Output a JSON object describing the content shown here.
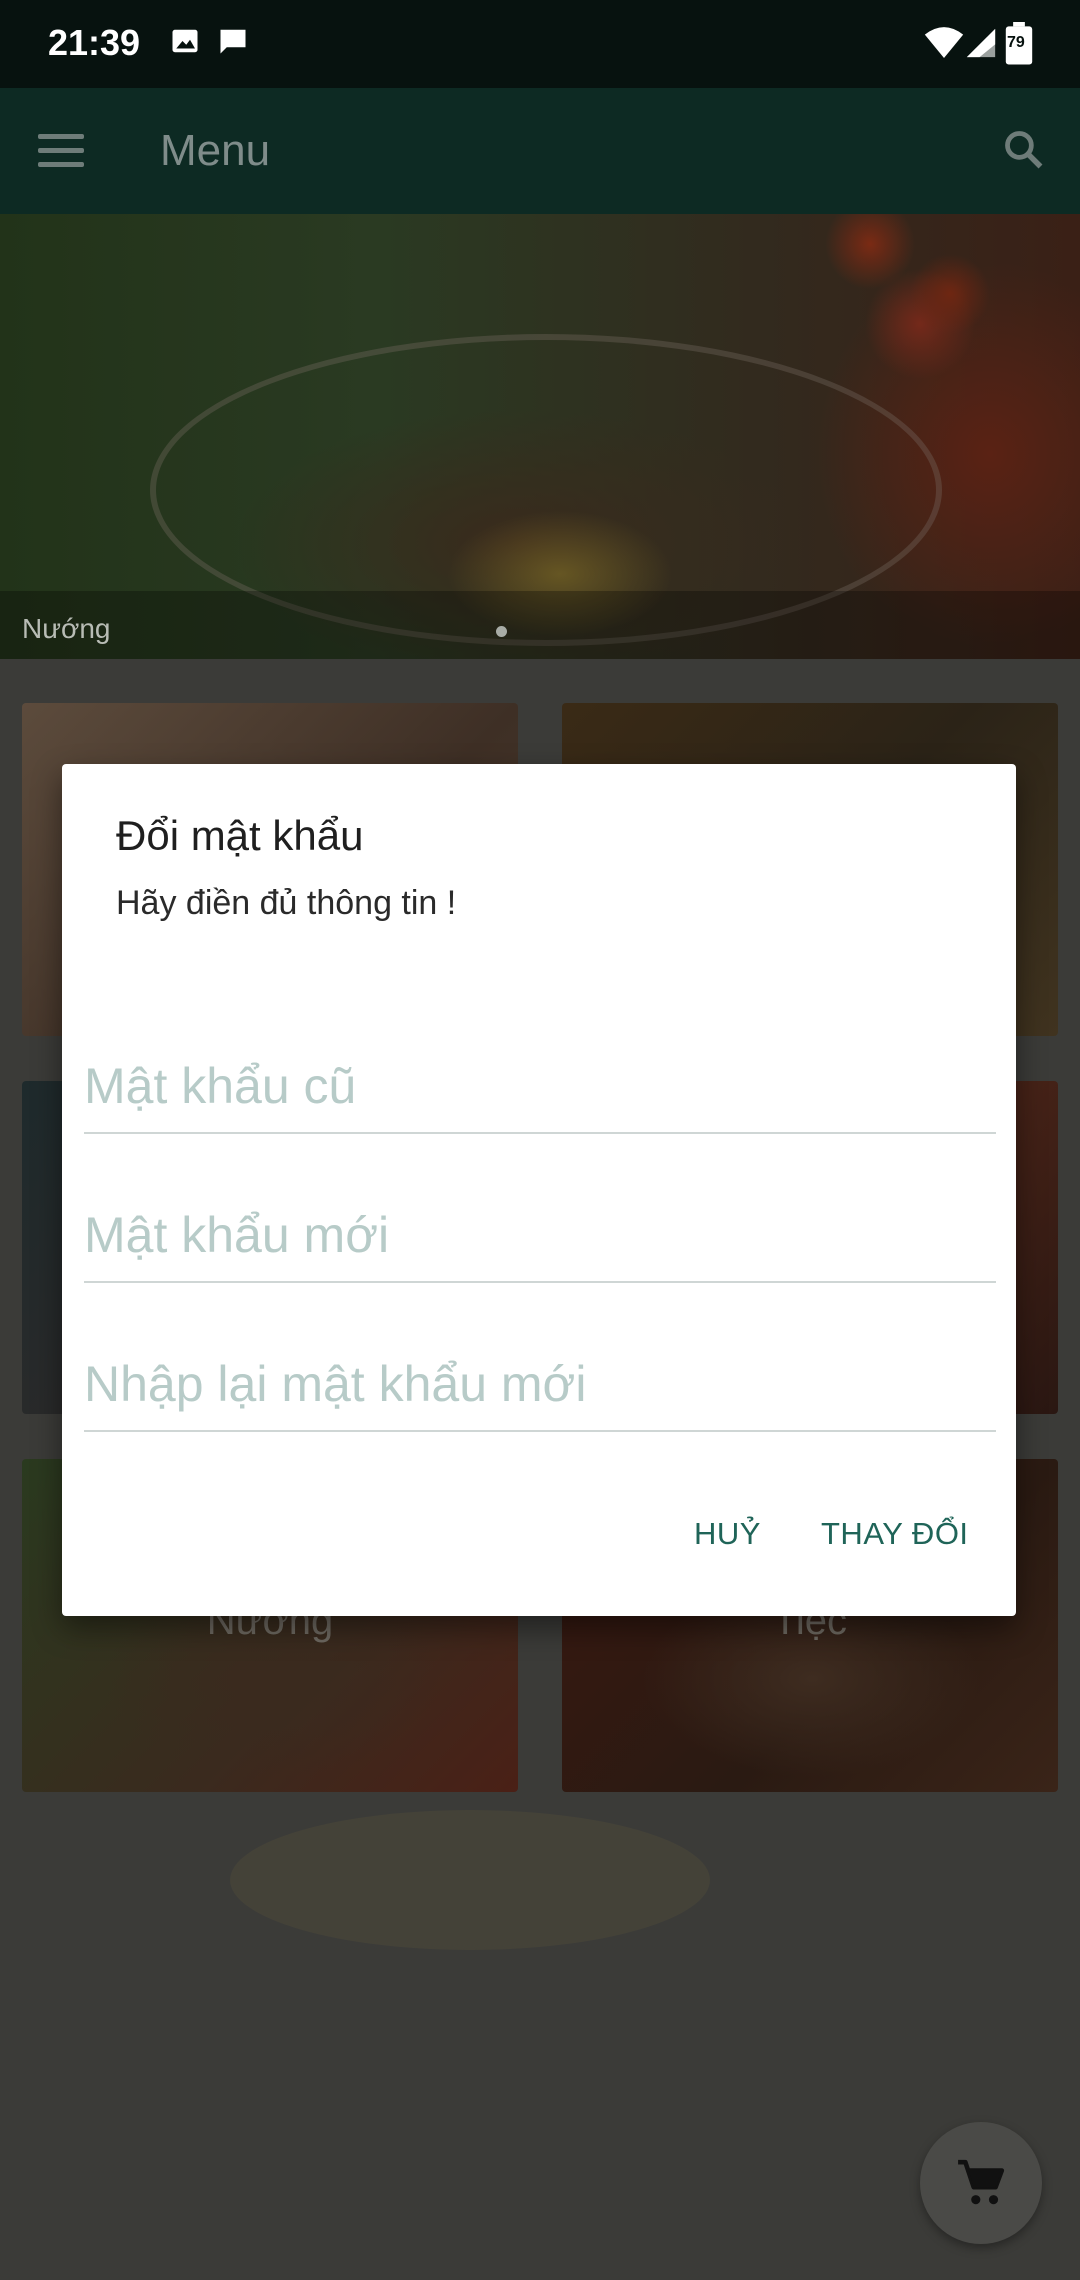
{
  "status_bar": {
    "time": "21:39",
    "battery": "79"
  },
  "app_bar": {
    "title": "Menu"
  },
  "hero": {
    "caption": "Nướng"
  },
  "categories": [
    {
      "label": ""
    },
    {
      "label": ""
    },
    {
      "label": ""
    },
    {
      "label": ""
    },
    {
      "label": "Nướng"
    },
    {
      "label": "Tiệc"
    }
  ],
  "dialog": {
    "title": "Đổi mật khẩu",
    "message": "Hãy điền đủ thông tin !",
    "fields": {
      "old_password": {
        "placeholder": "Mật khẩu cũ",
        "value": ""
      },
      "new_password": {
        "placeholder": "Mật khẩu mới",
        "value": ""
      },
      "confirm_password": {
        "placeholder": "Nhập lại mật khẩu mới",
        "value": ""
      }
    },
    "cancel_label": "HUỶ",
    "confirm_label": "THAY ĐỔI"
  },
  "colors": {
    "accent": "#1f6458",
    "app_bar": "#0d2a23",
    "status_bar": "#07120f",
    "hint": "#b7cbc8"
  },
  "icons": [
    "image-notification-icon",
    "message-notification-icon",
    "wifi-icon",
    "signal-icon",
    "battery-icon",
    "menu-icon",
    "search-icon",
    "cart-icon"
  ]
}
